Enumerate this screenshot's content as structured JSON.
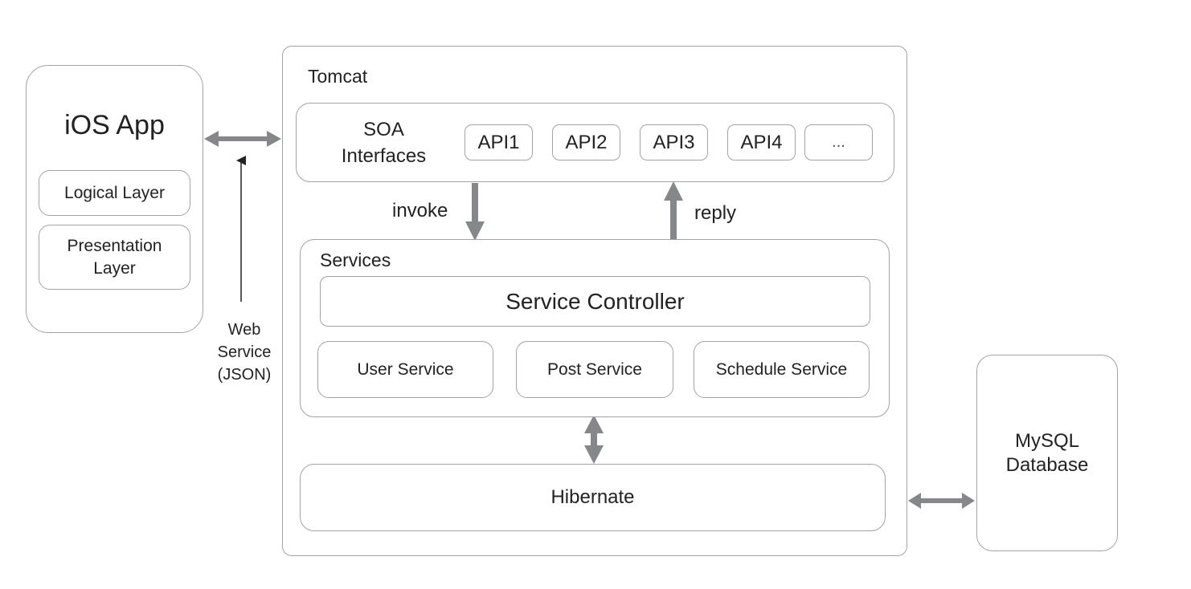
{
  "ios_app": {
    "title": "iOS App",
    "layers": [
      "Logical Layer",
      "Presentation\nLayer"
    ]
  },
  "connection": {
    "label_lines": [
      "Web",
      "Service",
      "(JSON)"
    ]
  },
  "tomcat": {
    "title": "Tomcat",
    "soa": {
      "title_lines": [
        "SOA",
        "Interfaces"
      ],
      "apis": [
        "API1",
        "API2",
        "API3",
        "API4",
        "..."
      ]
    },
    "invoke_label": "invoke",
    "reply_label": "reply",
    "services": {
      "title": "Services",
      "controller": "Service Controller",
      "items": [
        "User Service",
        "Post Service",
        "Schedule Service"
      ]
    },
    "hibernate": "Hibernate"
  },
  "database": {
    "title_lines": [
      "MySQL",
      "Database"
    ]
  },
  "colors": {
    "arrow": "#85878a",
    "border": "#a3a3a6"
  }
}
